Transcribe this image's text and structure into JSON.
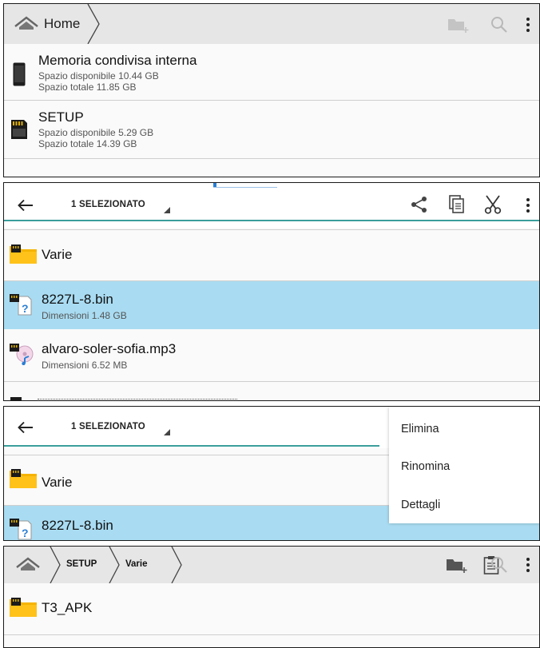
{
  "panel1": {
    "breadcrumb_home": "Home",
    "items": [
      {
        "title": "Memoria condivisa interna",
        "free": "Spazio disponibile 10.44 GB",
        "total": "Spazio totale 11.85 GB"
      },
      {
        "title": "SETUP",
        "free": "Spazio disponibile 5.29 GB",
        "total": "Spazio totale 14.39 GB"
      }
    ]
  },
  "panel2": {
    "selection_label": "1 SELEZIONATO",
    "items": [
      {
        "name": "Varie"
      },
      {
        "name": "8227L-8.bin",
        "size": "Dimensioni 1.48 GB"
      },
      {
        "name": "alvaro-soler-sofia.mp3",
        "size": "Dimensioni 6.52 MB"
      }
    ]
  },
  "panel3": {
    "selection_label": "1 SELEZIONATO",
    "items": [
      {
        "name": "Varie"
      },
      {
        "name": "8227L-8.bin"
      }
    ],
    "menu": [
      "Elimina",
      "Rinomina",
      "Dettagli"
    ]
  },
  "panel4": {
    "breadcrumbs": [
      "SETUP",
      "Varie"
    ],
    "items": [
      {
        "name": "T3_APK"
      }
    ]
  },
  "colors": {
    "selected_row": "#a9dcf2",
    "accent_line": "#3a9e9a",
    "folder": "#f5b400",
    "toolbar": "#e6e6e6"
  },
  "icons": [
    "home-icon",
    "new-folder-icon",
    "search-icon",
    "overflow-menu-icon",
    "back-arrow-icon",
    "share-icon",
    "copy-icon",
    "cut-icon",
    "paste-icon",
    "folder-icon",
    "phone-icon",
    "sd-card-icon",
    "unknown-file-icon",
    "audio-file-icon"
  ]
}
